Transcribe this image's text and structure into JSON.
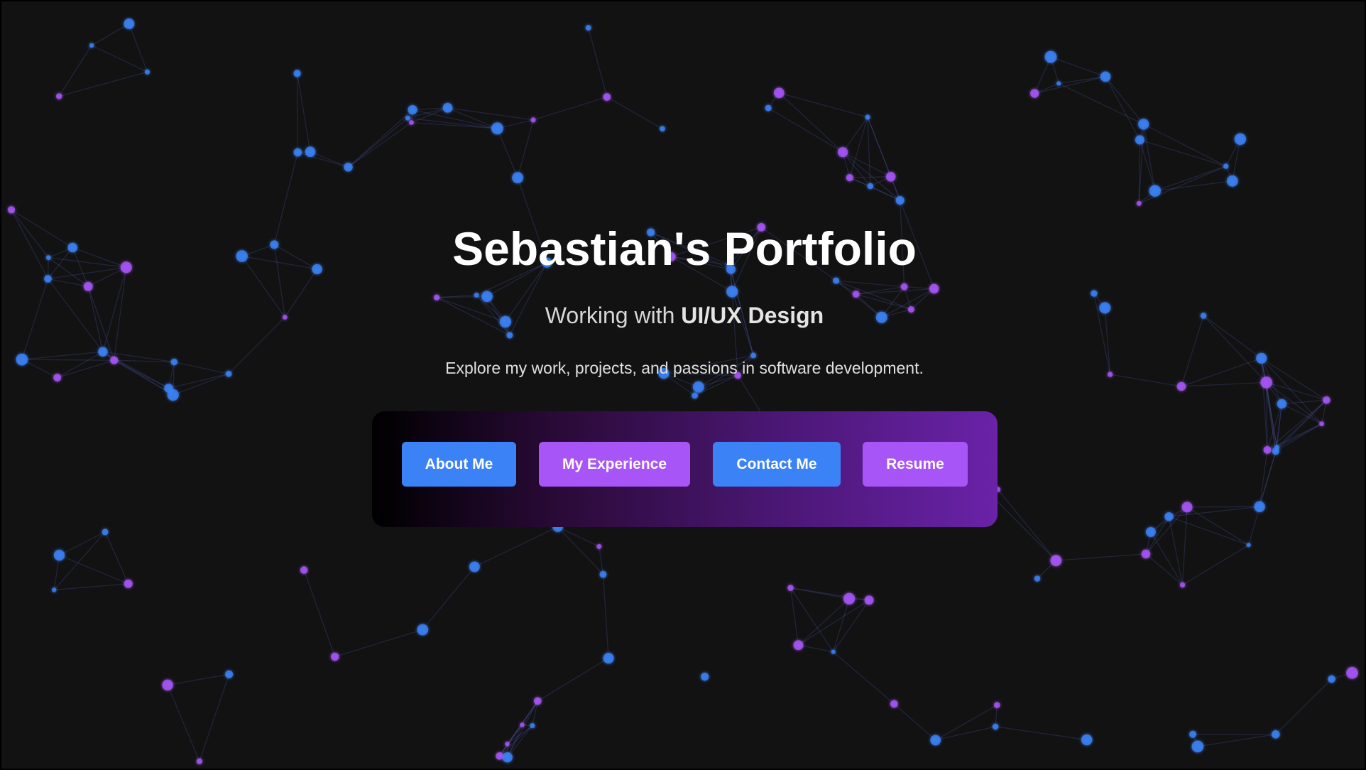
{
  "hero": {
    "title": "Sebastian's Portfolio",
    "subtitle_prefix": "Working with ",
    "subtitle_emphasis": "UI/UX Design",
    "tagline": "Explore my work, projects, and passions in software development."
  },
  "nav_buttons": {
    "about": "About Me",
    "experience": "My Experience",
    "contact": "Contact Me",
    "resume": "Resume"
  },
  "colors": {
    "background": "#121212",
    "node_blue": "#3b82f6",
    "node_purple": "#a855f7",
    "button_blue": "#3b82f6",
    "button_purple": "#a855f7"
  }
}
